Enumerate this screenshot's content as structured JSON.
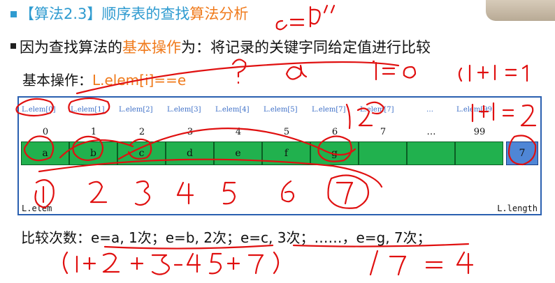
{
  "slide": {
    "title_prefix": "【算法2.3】顺序表的查找",
    "title_highlight": "算法分析",
    "point_prefix": "因为查找算法的",
    "point_highlight": "基本操作",
    "point_suffix": "为：将记录的关键字同给定值进行比较",
    "basic_label": "基本操作：",
    "basic_expr": "L.elem[i]==e",
    "elem_labels": [
      "L.elem[0]",
      "L.elem[1]",
      "L.elem[2]",
      "L.elem[3]",
      "L.elem[4]",
      "L.elem[5]",
      "L.elem[7]",
      "L.elem[7]",
      "…",
      "L.elem[99]"
    ],
    "indices": [
      "0",
      "1",
      "2",
      "3",
      "4",
      "5",
      "6",
      "7",
      "…",
      "99"
    ],
    "cells": [
      "a",
      "b",
      "c",
      "d",
      "e",
      "f",
      "g",
      "",
      "",
      ""
    ],
    "length_value": "7",
    "footer_left": "L.elem",
    "footer_right": "L.length",
    "comparison_text": "比较次数：e=a, 1次；e=b, 2次；e=c, 3次；……，e=g, 7次；"
  },
  "colors": {
    "accent_blue": "#2f9bd0",
    "accent_orange": "#f07a1b",
    "cell_green": "#21b14e",
    "length_blue": "#4f86d6",
    "ink_red": "#e01010"
  }
}
